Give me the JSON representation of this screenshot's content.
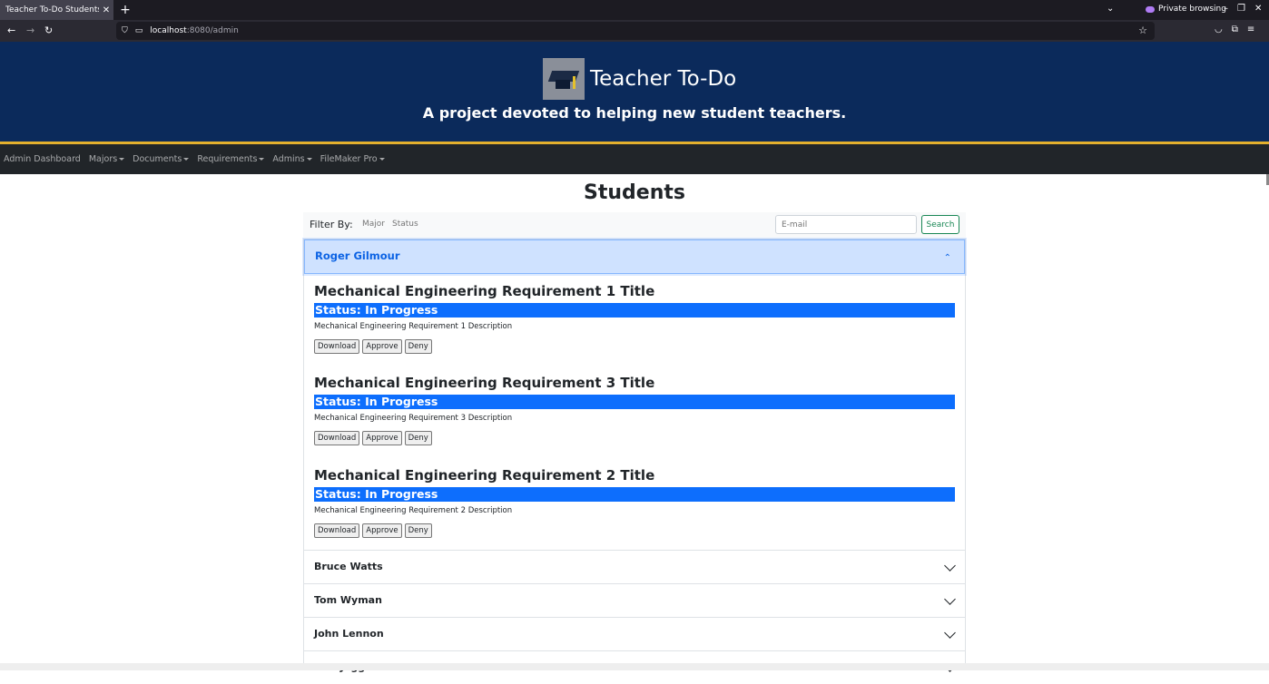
{
  "browser": {
    "tab_title": "Teacher To-Do Students",
    "tab_close": "✕",
    "new_tab": "+",
    "tab_list": "⌄",
    "private_label": "Private browsing",
    "url_host": "localhost",
    "url_path": ":8080/admin",
    "back": "←",
    "forward": "→",
    "reload": "↻",
    "minimize": "–",
    "restore": "❐",
    "close": "✕",
    "star": "☆",
    "menu": "≡"
  },
  "site": {
    "title": "Teacher To-Do",
    "subtitle": "A project devoted to helping new student teachers."
  },
  "nav": {
    "items": [
      {
        "label": "Admin Dashboard",
        "dropdown": false
      },
      {
        "label": "Majors",
        "dropdown": true
      },
      {
        "label": "Documents",
        "dropdown": true
      },
      {
        "label": "Requirements",
        "dropdown": true
      },
      {
        "label": "Admins",
        "dropdown": true
      },
      {
        "label": "FileMaker Pro",
        "dropdown": true
      }
    ]
  },
  "page": {
    "title": "Students"
  },
  "filter": {
    "label": "Filter By:",
    "major": "Major",
    "status": "Status",
    "email_placeholder": "E-mail",
    "search_label": "Search"
  },
  "students": {
    "open": {
      "name": "Roger Gilmour",
      "requirements": [
        {
          "title": "Mechanical Engineering Requirement 1 Title",
          "status": "Status: In Progress",
          "description": "Mechanical Engineering Requirement 1 Description"
        },
        {
          "title": "Mechanical Engineering Requirement 3 Title",
          "status": "Status: In Progress",
          "description": "Mechanical Engineering Requirement 3 Description"
        },
        {
          "title": "Mechanical Engineering Requirement 2 Title",
          "status": "Status: In Progress",
          "description": "Mechanical Engineering Requirement 2 Description"
        }
      ]
    },
    "buttons": {
      "download": "Download",
      "approve": "Approve",
      "deny": "Deny"
    },
    "collapsed": [
      {
        "name": "Bruce Watts"
      },
      {
        "name": "Tom Wyman"
      },
      {
        "name": "John Lennon"
      },
      {
        "name": "Tom Jagger"
      }
    ]
  }
}
